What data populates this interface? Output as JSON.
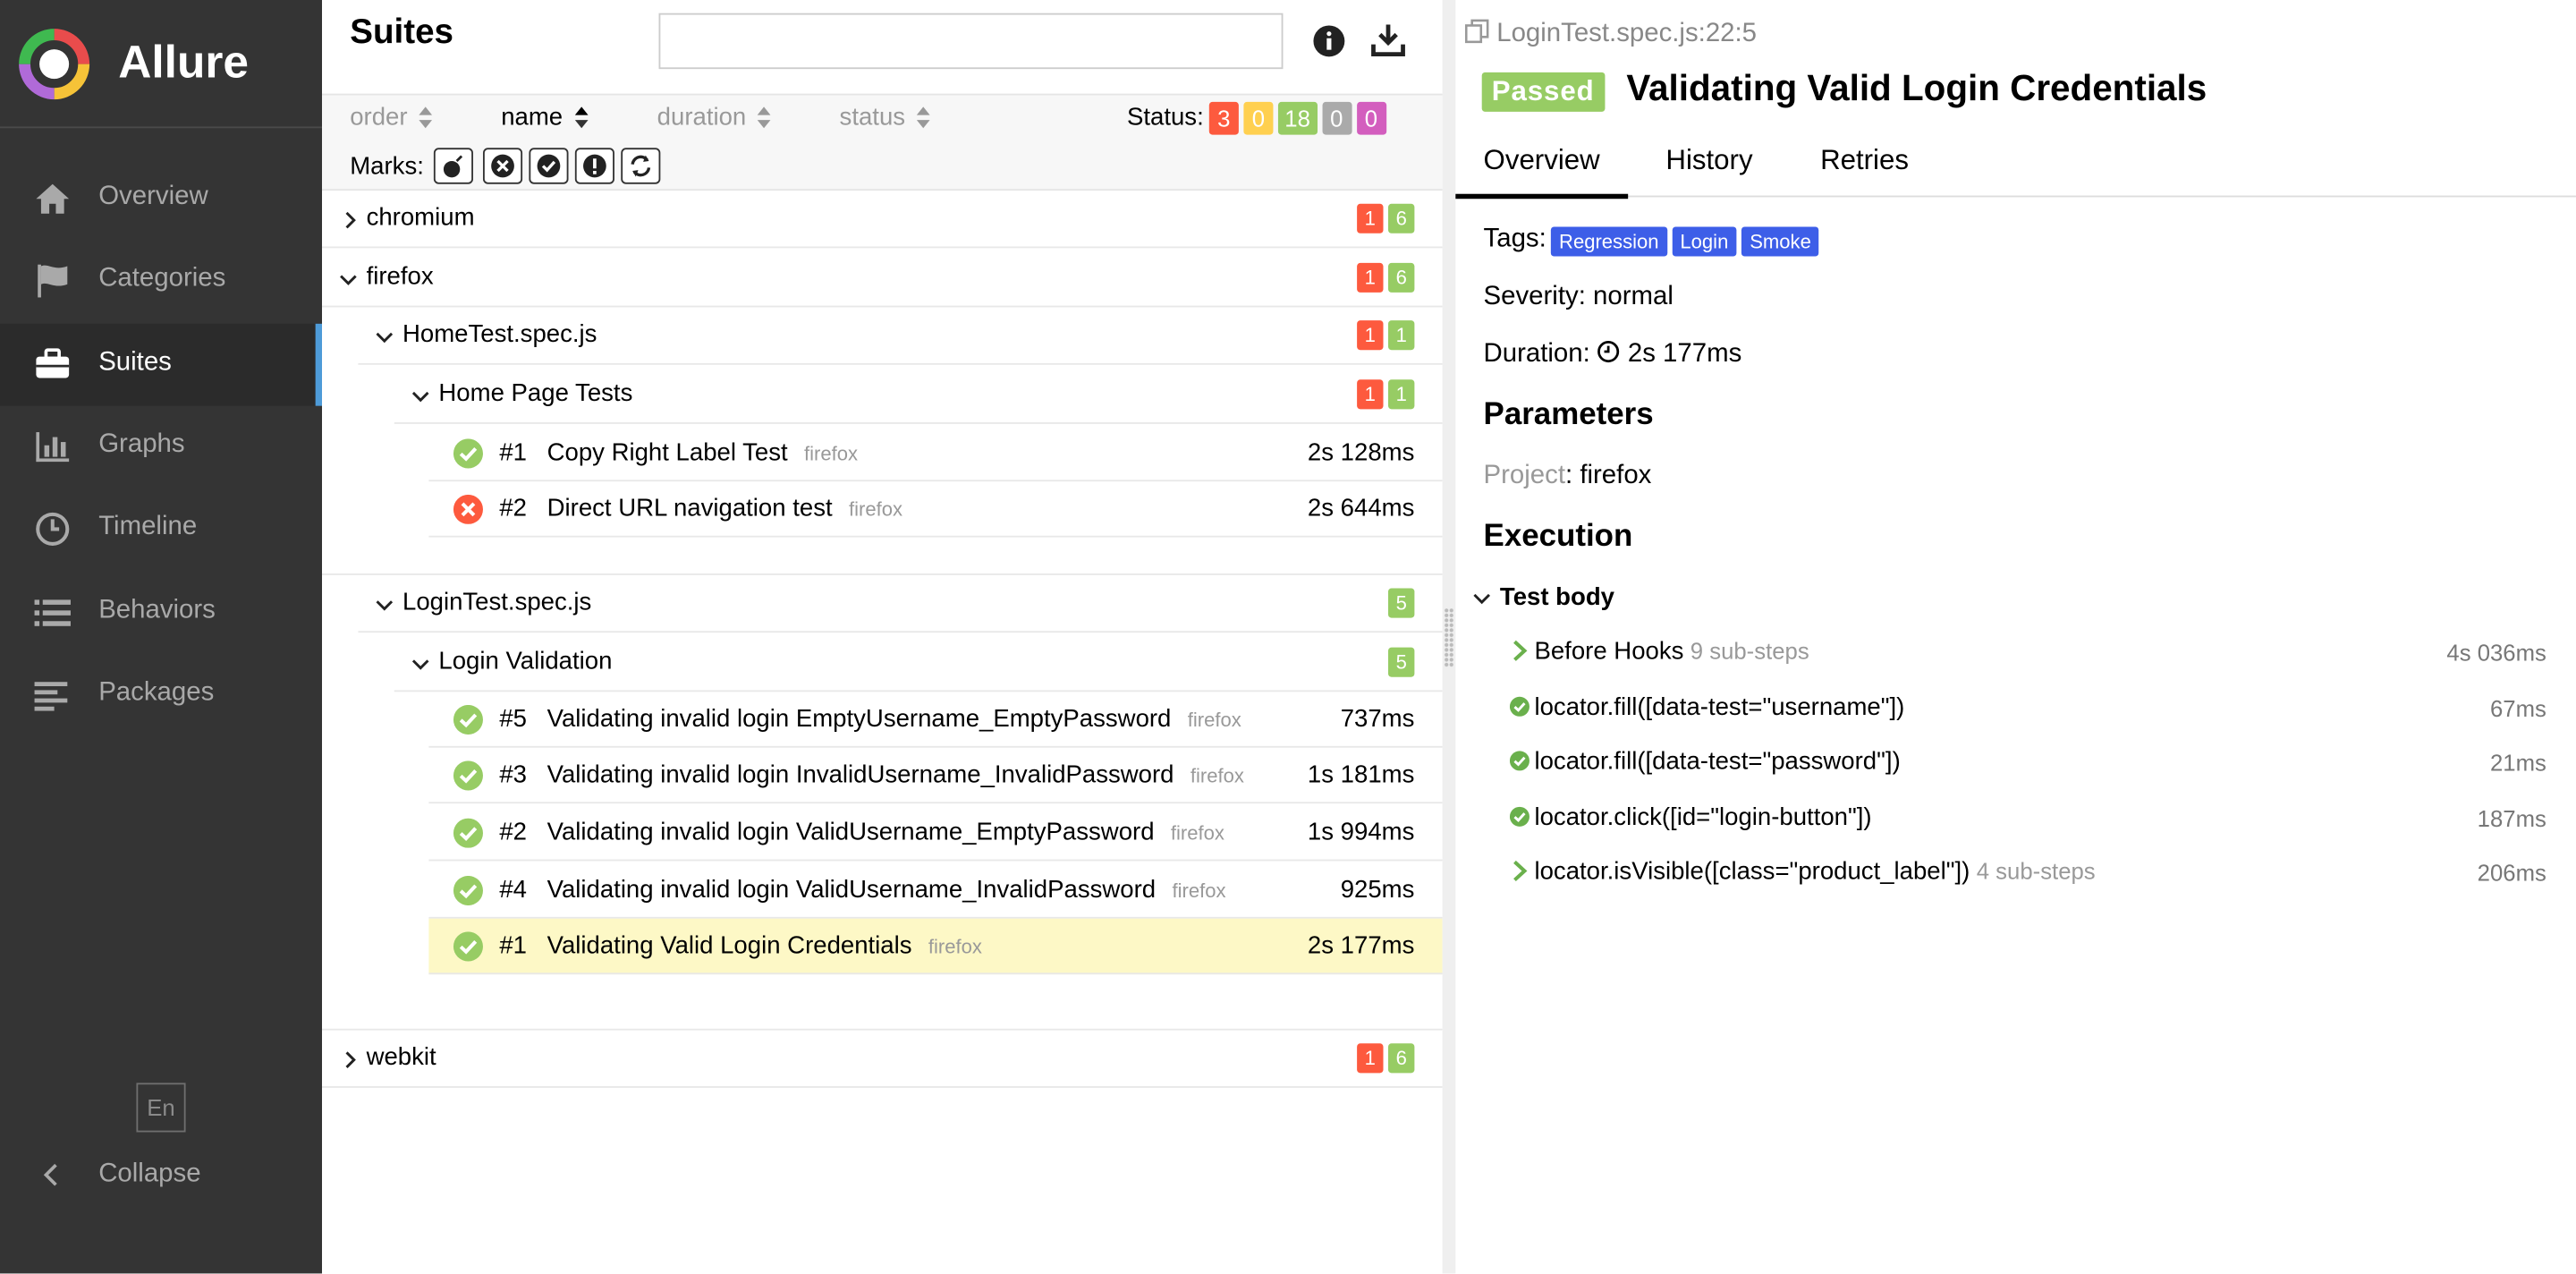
{
  "app": {
    "name": "Allure"
  },
  "colors": {
    "sidebar_bg": "#343434",
    "accent": "#4e9bd8",
    "failed": "#fd5a3e",
    "broken": "#ffd050",
    "passed": "#97cc64",
    "skipped": "#aaaaaa",
    "unknown": "#d35ebe",
    "tag": "#3d5ee8",
    "selected_row": "#fdf8c6"
  },
  "sidebar": {
    "items": [
      {
        "label": "Overview",
        "icon": "home-icon",
        "active": false
      },
      {
        "label": "Categories",
        "icon": "flag-icon",
        "active": false
      },
      {
        "label": "Suites",
        "icon": "briefcase-icon",
        "active": true
      },
      {
        "label": "Graphs",
        "icon": "bar-chart-icon",
        "active": false
      },
      {
        "label": "Timeline",
        "icon": "clock-icon",
        "active": false
      },
      {
        "label": "Behaviors",
        "icon": "list-icon",
        "active": false
      },
      {
        "label": "Packages",
        "icon": "align-left-icon",
        "active": false
      }
    ],
    "language": "En",
    "collapse_label": "Collapse"
  },
  "suites": {
    "title": "Suites",
    "search_value": "",
    "sorters": [
      {
        "label": "order",
        "active": false
      },
      {
        "label": "name",
        "active": true
      },
      {
        "label": "duration",
        "active": false
      },
      {
        "label": "status",
        "active": false
      }
    ],
    "status_label": "Status:",
    "status_counts": {
      "failed": "3",
      "broken": "0",
      "passed": "18",
      "skipped": "0",
      "unknown": "0"
    },
    "marks_label": "Marks:",
    "marks": [
      "flaky-icon",
      "new-failed-icon",
      "new-passed-icon",
      "new-broken-icon",
      "retries-status-change-icon"
    ],
    "groups": {
      "chromium": {
        "name": "chromium",
        "failed": "1",
        "passed": "6"
      },
      "firefox": {
        "name": "firefox",
        "failed": "1",
        "passed": "6"
      },
      "home_spec": {
        "name": "HomeTest.spec.js",
        "failed": "1",
        "passed": "1"
      },
      "home_suite": {
        "name": "Home Page Tests",
        "failed": "1",
        "passed": "1"
      },
      "login_spec": {
        "name": "LoginTest.spec.js",
        "passed": "5"
      },
      "login_suite": {
        "name": "Login Validation",
        "passed": "5"
      },
      "webkit": {
        "name": "webkit",
        "failed": "1",
        "passed": "6"
      }
    },
    "home_tests": [
      {
        "num": "#1",
        "name": "Copy Right Label Test",
        "project": "firefox",
        "duration": "2s 128ms",
        "status": "passed"
      },
      {
        "num": "#2",
        "name": "Direct URL navigation test",
        "project": "firefox",
        "duration": "2s 644ms",
        "status": "failed"
      }
    ],
    "login_tests": [
      {
        "num": "#5",
        "name": "Validating invalid login EmptyUsername_EmptyPassword",
        "project": "firefox",
        "duration": "737ms",
        "status": "passed"
      },
      {
        "num": "#3",
        "name": "Validating invalid login InvalidUsername_InvalidPassword",
        "project": "firefox",
        "duration": "1s 181ms",
        "status": "passed"
      },
      {
        "num": "#2",
        "name": "Validating invalid login ValidUsername_EmptyPassword",
        "project": "firefox",
        "duration": "1s 994ms",
        "status": "passed"
      },
      {
        "num": "#4",
        "name": "Validating invalid login ValidUsername_InvalidPassword",
        "project": "firefox",
        "duration": "925ms",
        "status": "passed"
      },
      {
        "num": "#1",
        "name": "Validating Valid Login Credentials",
        "project": "firefox",
        "duration": "2s 177ms",
        "status": "passed",
        "selected": true
      }
    ]
  },
  "detail": {
    "location": "LoginTest.spec.js:22:5",
    "status": "Passed",
    "title": "Validating Valid Login Credentials",
    "tabs": [
      "Overview",
      "History",
      "Retries"
    ],
    "tags_label": "Tags:",
    "tags": [
      "Regression",
      "Login",
      "Smoke"
    ],
    "severity_label": "Severity:",
    "severity": "normal",
    "duration_label": "Duration:",
    "duration": "2s 177ms",
    "parameters_heading": "Parameters",
    "param_name": "Project",
    "param_value": "firefox",
    "execution_heading": "Execution",
    "test_body_label": "Test body",
    "steps": [
      {
        "text": "Before Hooks",
        "sub": "9 sub-steps",
        "duration": "4s 036ms",
        "kind": "group"
      },
      {
        "text": "locator.fill([data-test=\"username\"])",
        "sub": "",
        "duration": "67ms",
        "kind": "passed"
      },
      {
        "text": "locator.fill([data-test=\"password\"])",
        "sub": "",
        "duration": "21ms",
        "kind": "passed"
      },
      {
        "text": "locator.click([id=\"login-button\"])",
        "sub": "",
        "duration": "187ms",
        "kind": "passed"
      },
      {
        "text": "locator.isVisible([class=\"product_label\"])",
        "sub": "4 sub-steps",
        "duration": "206ms",
        "kind": "group"
      }
    ]
  }
}
